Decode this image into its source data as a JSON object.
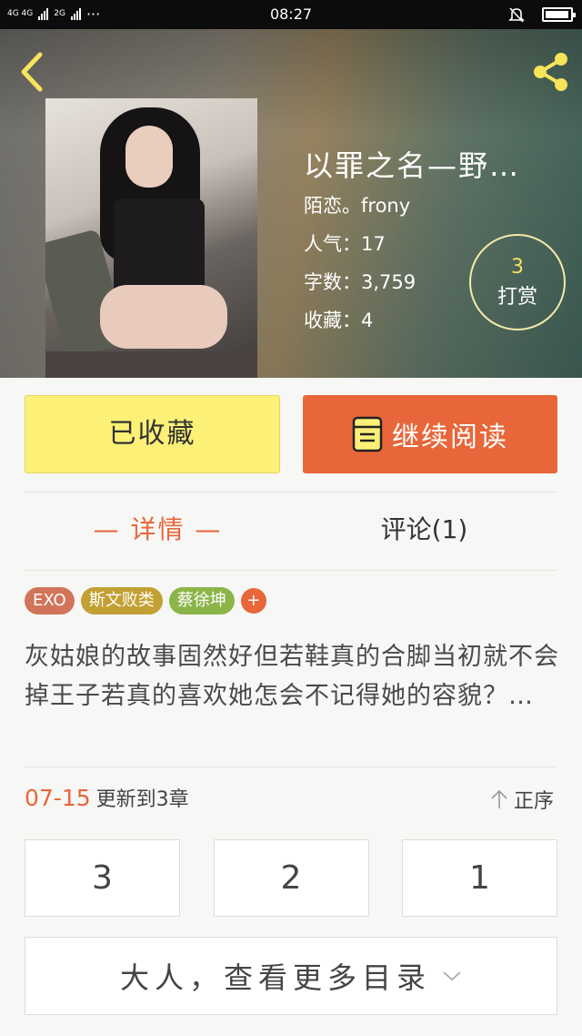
{
  "status_bar": {
    "network_left": "4G 4G",
    "network_right": "2G",
    "dots": "···",
    "time": "08:27"
  },
  "header": {
    "back_icon": "chevron-left-icon",
    "share_icon": "share-icon",
    "title": "以罪之名—野…",
    "author": "陌恋。frony",
    "popularity": "人气：17",
    "word_count": "字数：3,759",
    "favorites": "收藏：4",
    "reward": {
      "count": "3",
      "label": "打赏"
    }
  },
  "actions": {
    "collected_label": "已收藏",
    "continue_label": "继续阅读",
    "continue_icon": "book-icon"
  },
  "tabs": {
    "detail": "— 详情 —",
    "comments": "评论(1)"
  },
  "tags": [
    {
      "label": "EXO",
      "color": "#d2745a"
    },
    {
      "label": "斯文败类",
      "color": "#c3a032"
    },
    {
      "label": "蔡徐坤",
      "color": "#8bb548"
    }
  ],
  "tag_add": "+",
  "description": "灰姑娘的故事固然好但若鞋真的合脚当初就不会掉王子若真的喜欢她怎会不记得她的容貌？…",
  "update": {
    "date": "07-15",
    "text": "更新到3章",
    "sort_label": "正序"
  },
  "chapters": [
    "3",
    "2",
    "1"
  ],
  "more_toc": "大人，查看更多目录",
  "colors": {
    "accent": "#e8663a",
    "collected_bg": "#fcf176",
    "reward_count": "#f3e063"
  }
}
